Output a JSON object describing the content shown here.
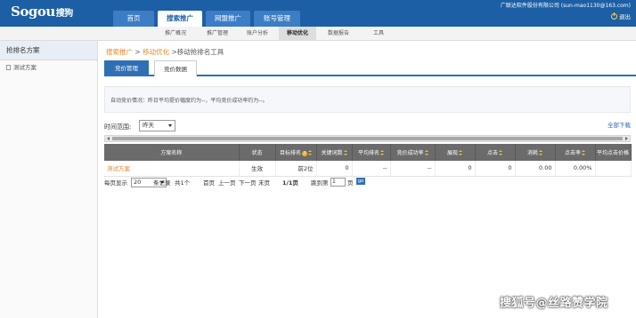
{
  "header": {
    "logo_text": "Sogou",
    "logo_cn": "搜狗",
    "account": "广联达软件股份有限公司 (sun-mao1130@163.com)",
    "logout": "退出",
    "nav_tabs": [
      {
        "label": "首页",
        "active": false
      },
      {
        "label": "搜索推广",
        "active": true
      },
      {
        "label": "网盟推广",
        "active": false
      },
      {
        "label": "账号管理",
        "active": false
      }
    ]
  },
  "subnav": {
    "items": [
      {
        "label": "推广概况",
        "active": false
      },
      {
        "label": "推广管理",
        "active": false
      },
      {
        "label": "账户分析",
        "active": false
      },
      {
        "label": "移动优化",
        "active": true
      },
      {
        "label": "数据报告",
        "active": false
      },
      {
        "label": "工具",
        "active": false
      }
    ]
  },
  "sidebar": {
    "title": "抢排名方案",
    "items": [
      {
        "label": "测试方案"
      }
    ]
  },
  "breadcrumb": {
    "parts": [
      "搜索推广",
      "移动优化",
      "移动抢排名工具"
    ],
    "separator": ">"
  },
  "page_tabs": [
    {
      "label": "竞价管理",
      "active": false
    },
    {
      "label": "竞价数据",
      "active": true
    }
  ],
  "notice": "自动竞价情况：昨日平均提价幅度约为--，平均竞价成功率约为--。",
  "filters": {
    "range_label": "时间范围:",
    "range_value": "昨天",
    "download": "全部下载"
  },
  "table": {
    "headers": [
      "方案名称",
      "状态",
      "目标排名",
      "关键词数",
      "平均排名",
      "竞价成功率",
      "展现",
      "点击",
      "消耗",
      "点击率",
      "平均点击价格"
    ],
    "rows": [
      [
        "测试方案",
        "生效",
        "前2位",
        "0",
        "--",
        "--",
        "0",
        "0",
        "0.00",
        "0.00%",
        ""
      ]
    ]
  },
  "pager": {
    "per_page_label": "每页显示",
    "per_page": "20",
    "records_label": "条记录",
    "total": "共1个",
    "first": "首页",
    "prev": "上一页",
    "next": "下一页",
    "last": "末页",
    "page_info": "1/1页",
    "jump_label": "跳到第",
    "jump_value": "1",
    "page_suffix": "页",
    "go": "go"
  },
  "watermark": "搜狐号@丝路赞学院",
  "colors": {
    "brand_blue": "#1c5fa4",
    "tab_blue": "#2f6fb5",
    "link_orange": "#e58a2c",
    "table_header": "#6b6b6b"
  }
}
